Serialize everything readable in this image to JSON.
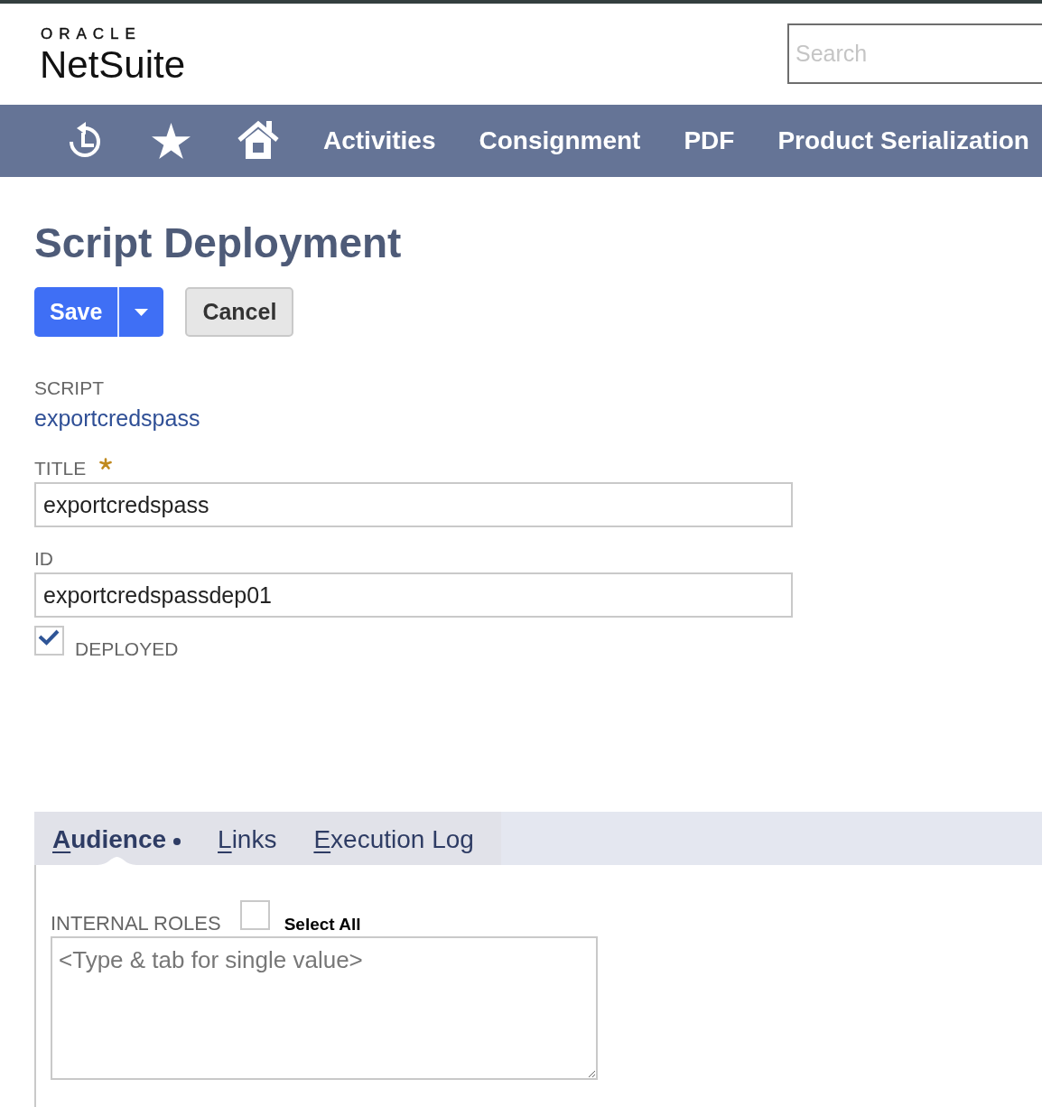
{
  "logo": {
    "top_line": "ORACLE",
    "wordmark": "NetSuite"
  },
  "search": {
    "placeholder": "Search"
  },
  "nav": {
    "items": [
      "Activities",
      "Consignment",
      "PDF",
      "Product Serialization"
    ]
  },
  "page_title": "Script Deployment",
  "actions": {
    "save": "Save",
    "cancel": "Cancel"
  },
  "fields": [
    {
      "kind": "link",
      "label": "SCRIPT",
      "value": "exportcredspass",
      "required": false
    },
    {
      "kind": "input",
      "label": "TITLE",
      "value": "exportcredspass",
      "required": true
    },
    {
      "kind": "input",
      "label": "ID",
      "value": "exportcredspassdep01",
      "required": false
    }
  ],
  "deployed": {
    "label": "DEPLOYED",
    "checked": true
  },
  "subtabs": [
    {
      "label": "Audience",
      "selected": true
    },
    {
      "label": "Links",
      "selected": false
    },
    {
      "label": "Execution Log",
      "selected": false
    }
  ],
  "audience": {
    "internal_roles": {
      "label": "INTERNAL ROLES",
      "select_all": {
        "label": "Select All",
        "checked": false
      },
      "placeholder": "<Type & tab for single value>"
    }
  }
}
